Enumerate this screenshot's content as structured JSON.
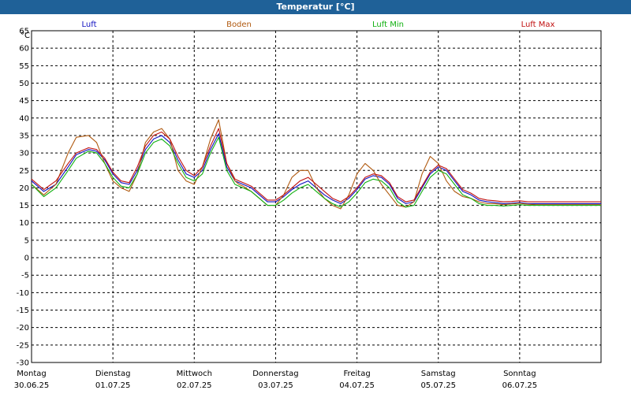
{
  "window": {
    "title": "Temperatur [°C]"
  },
  "chart_data": {
    "type": "line",
    "unit_label": "°C",
    "ylim": [
      -30,
      65
    ],
    "yticks": [
      65,
      60,
      55,
      50,
      45,
      40,
      35,
      30,
      25,
      20,
      15,
      10,
      5,
      0,
      -5,
      -10,
      -15,
      -20,
      -25,
      -30
    ],
    "xlim": [
      0,
      7
    ],
    "x_ticks": [
      {
        "day": "Montag",
        "date": "30.06.25"
      },
      {
        "day": "Dienstag",
        "date": "01.07.25"
      },
      {
        "day": "Mittwoch",
        "date": "02.07.25"
      },
      {
        "day": "Donnerstag",
        "date": "03.07.25"
      },
      {
        "day": "Freitag",
        "date": "04.07.25"
      },
      {
        "day": "Samstag",
        "date": "05.07.25"
      },
      {
        "day": "Sonntag",
        "date": "06.07.25"
      }
    ],
    "grid": true,
    "legend_position": "top",
    "series": [
      {
        "name": "Luft",
        "color": "#1010c0",
        "x": [
          0,
          0.15,
          0.3,
          0.45,
          0.55,
          0.7,
          0.8,
          0.9,
          1.0,
          1.1,
          1.2,
          1.3,
          1.4,
          1.5,
          1.6,
          1.7,
          1.8,
          1.9,
          2.0,
          2.1,
          2.2,
          2.3,
          2.4,
          2.5,
          2.55,
          2.6,
          2.7,
          2.8,
          2.9,
          3.0,
          3.1,
          3.2,
          3.3,
          3.4,
          3.5,
          3.6,
          3.7,
          3.8,
          3.9,
          4.0,
          4.1,
          4.2,
          4.3,
          4.4,
          4.5,
          4.6,
          4.7,
          4.8,
          4.9,
          5.0,
          5.1,
          5.2,
          5.3,
          5.4,
          5.5,
          5.6,
          5.7,
          5.8,
          5.9,
          6.0,
          6.1,
          6.2,
          6.3,
          6.5,
          6.7,
          6.9,
          7.0
        ],
        "y": [
          22,
          19,
          21,
          26,
          29.5,
          31,
          30.5,
          28,
          24,
          21.5,
          21,
          25,
          31,
          34,
          35,
          33,
          28,
          24,
          23,
          25,
          31,
          35.5,
          26,
          22,
          21.5,
          21,
          20,
          18,
          16,
          16,
          17.5,
          19.5,
          21,
          22,
          20,
          18,
          16.5,
          15.5,
          17,
          19.5,
          22.5,
          23.5,
          23,
          21,
          17,
          15.5,
          16,
          20,
          24,
          26,
          25,
          22,
          19,
          18,
          16.5,
          16,
          15.8,
          15.5,
          15.6,
          15.8,
          15.5,
          15.5,
          15.5,
          15.5,
          15.5,
          15.5,
          15.5
        ]
      },
      {
        "name": "Boden",
        "color": "#b05a10",
        "x": [
          0,
          0.15,
          0.3,
          0.45,
          0.55,
          0.7,
          0.8,
          0.9,
          1.0,
          1.1,
          1.2,
          1.3,
          1.4,
          1.5,
          1.6,
          1.7,
          1.8,
          1.9,
          2.0,
          2.1,
          2.2,
          2.3,
          2.4,
          2.5,
          2.55,
          2.6,
          2.7,
          2.8,
          2.9,
          3.0,
          3.1,
          3.2,
          3.3,
          3.4,
          3.5,
          3.6,
          3.7,
          3.8,
          3.9,
          4.0,
          4.1,
          4.2,
          4.3,
          4.4,
          4.5,
          4.6,
          4.7,
          4.8,
          4.9,
          5.0,
          5.1,
          5.2,
          5.3,
          5.4,
          5.5,
          5.6,
          5.7,
          5.8,
          5.9,
          6.0,
          6.1,
          6.2,
          6.3,
          6.5,
          6.7,
          6.9,
          7.0
        ],
        "y": [
          21,
          18,
          21,
          30,
          34.5,
          35,
          33,
          27,
          22,
          20,
          19,
          24,
          33,
          36,
          37,
          34,
          25,
          22,
          21,
          26,
          34,
          39.5,
          27,
          22,
          21,
          20.5,
          19,
          17,
          15,
          15,
          18,
          23,
          25,
          25,
          20,
          17,
          15,
          14,
          18,
          24,
          27,
          25,
          21,
          18,
          15,
          14.5,
          16,
          24,
          29,
          27,
          22,
          19,
          17.5,
          17,
          16,
          15.5,
          15.5,
          15.2,
          15.4,
          15.6,
          15.3,
          15.2,
          15.2,
          15.2,
          15.2,
          15.2,
          15.2
        ]
      },
      {
        "name": "Luft Min",
        "color": "#10b010",
        "x": [
          0,
          0.15,
          0.3,
          0.45,
          0.55,
          0.7,
          0.8,
          0.9,
          1.0,
          1.1,
          1.2,
          1.3,
          1.4,
          1.5,
          1.6,
          1.7,
          1.8,
          1.9,
          2.0,
          2.1,
          2.2,
          2.3,
          2.4,
          2.5,
          2.55,
          2.6,
          2.7,
          2.8,
          2.9,
          3.0,
          3.1,
          3.2,
          3.3,
          3.4,
          3.5,
          3.6,
          3.7,
          3.8,
          3.9,
          4.0,
          4.1,
          4.2,
          4.3,
          4.4,
          4.5,
          4.6,
          4.7,
          4.8,
          4.9,
          5.0,
          5.1,
          5.2,
          5.3,
          5.4,
          5.5,
          5.6,
          5.7,
          5.8,
          5.9,
          6.0,
          6.1,
          6.2,
          6.3,
          6.5,
          6.7,
          6.9,
          7.0
        ],
        "y": [
          21,
          17.5,
          20,
          25,
          28.5,
          30.5,
          30,
          27,
          23,
          20.5,
          20,
          24,
          30,
          33,
          34,
          32,
          27,
          23,
          22,
          24,
          30,
          34.5,
          25,
          21,
          20.5,
          20,
          19,
          17,
          15,
          15,
          16.5,
          18.5,
          20,
          21,
          19,
          17,
          15.5,
          14.5,
          16,
          18.5,
          21.5,
          22.5,
          22,
          20,
          16,
          14.5,
          15,
          19,
          23,
          25,
          24,
          21,
          18,
          17,
          15.5,
          15,
          15,
          14.8,
          15,
          15.2,
          15,
          15,
          15,
          15,
          15,
          15,
          15
        ]
      },
      {
        "name": "Luft Max",
        "color": "#c01010",
        "x": [
          0,
          0.15,
          0.3,
          0.45,
          0.55,
          0.7,
          0.8,
          0.9,
          1.0,
          1.1,
          1.2,
          1.3,
          1.4,
          1.5,
          1.6,
          1.7,
          1.8,
          1.9,
          2.0,
          2.1,
          2.2,
          2.3,
          2.4,
          2.5,
          2.55,
          2.6,
          2.7,
          2.8,
          2.9,
          3.0,
          3.1,
          3.2,
          3.3,
          3.4,
          3.5,
          3.6,
          3.7,
          3.8,
          3.9,
          4.0,
          4.1,
          4.2,
          4.3,
          4.4,
          4.5,
          4.6,
          4.7,
          4.8,
          4.9,
          5.0,
          5.1,
          5.2,
          5.3,
          5.4,
          5.5,
          5.6,
          5.7,
          5.8,
          5.9,
          6.0,
          6.1,
          6.2,
          6.3,
          6.5,
          6.7,
          6.9,
          7.0
        ],
        "y": [
          22.5,
          19.5,
          22,
          27,
          30,
          31.5,
          31,
          28.5,
          24.5,
          22,
          21.5,
          26,
          32,
          35,
          36,
          34,
          29,
          25,
          23.5,
          26,
          32,
          37,
          27,
          22.5,
          22,
          21.5,
          20.5,
          18.5,
          16.5,
          16.5,
          18,
          20,
          22,
          23,
          21,
          19,
          17,
          16,
          17.5,
          20,
          23,
          24,
          23.5,
          21.5,
          17.5,
          16,
          16.5,
          20.5,
          24.5,
          26.5,
          25.5,
          22.5,
          19.5,
          18.5,
          17,
          16.5,
          16.3,
          16,
          16.1,
          16.3,
          16,
          16,
          16,
          16,
          16,
          16,
          16
        ]
      }
    ]
  }
}
